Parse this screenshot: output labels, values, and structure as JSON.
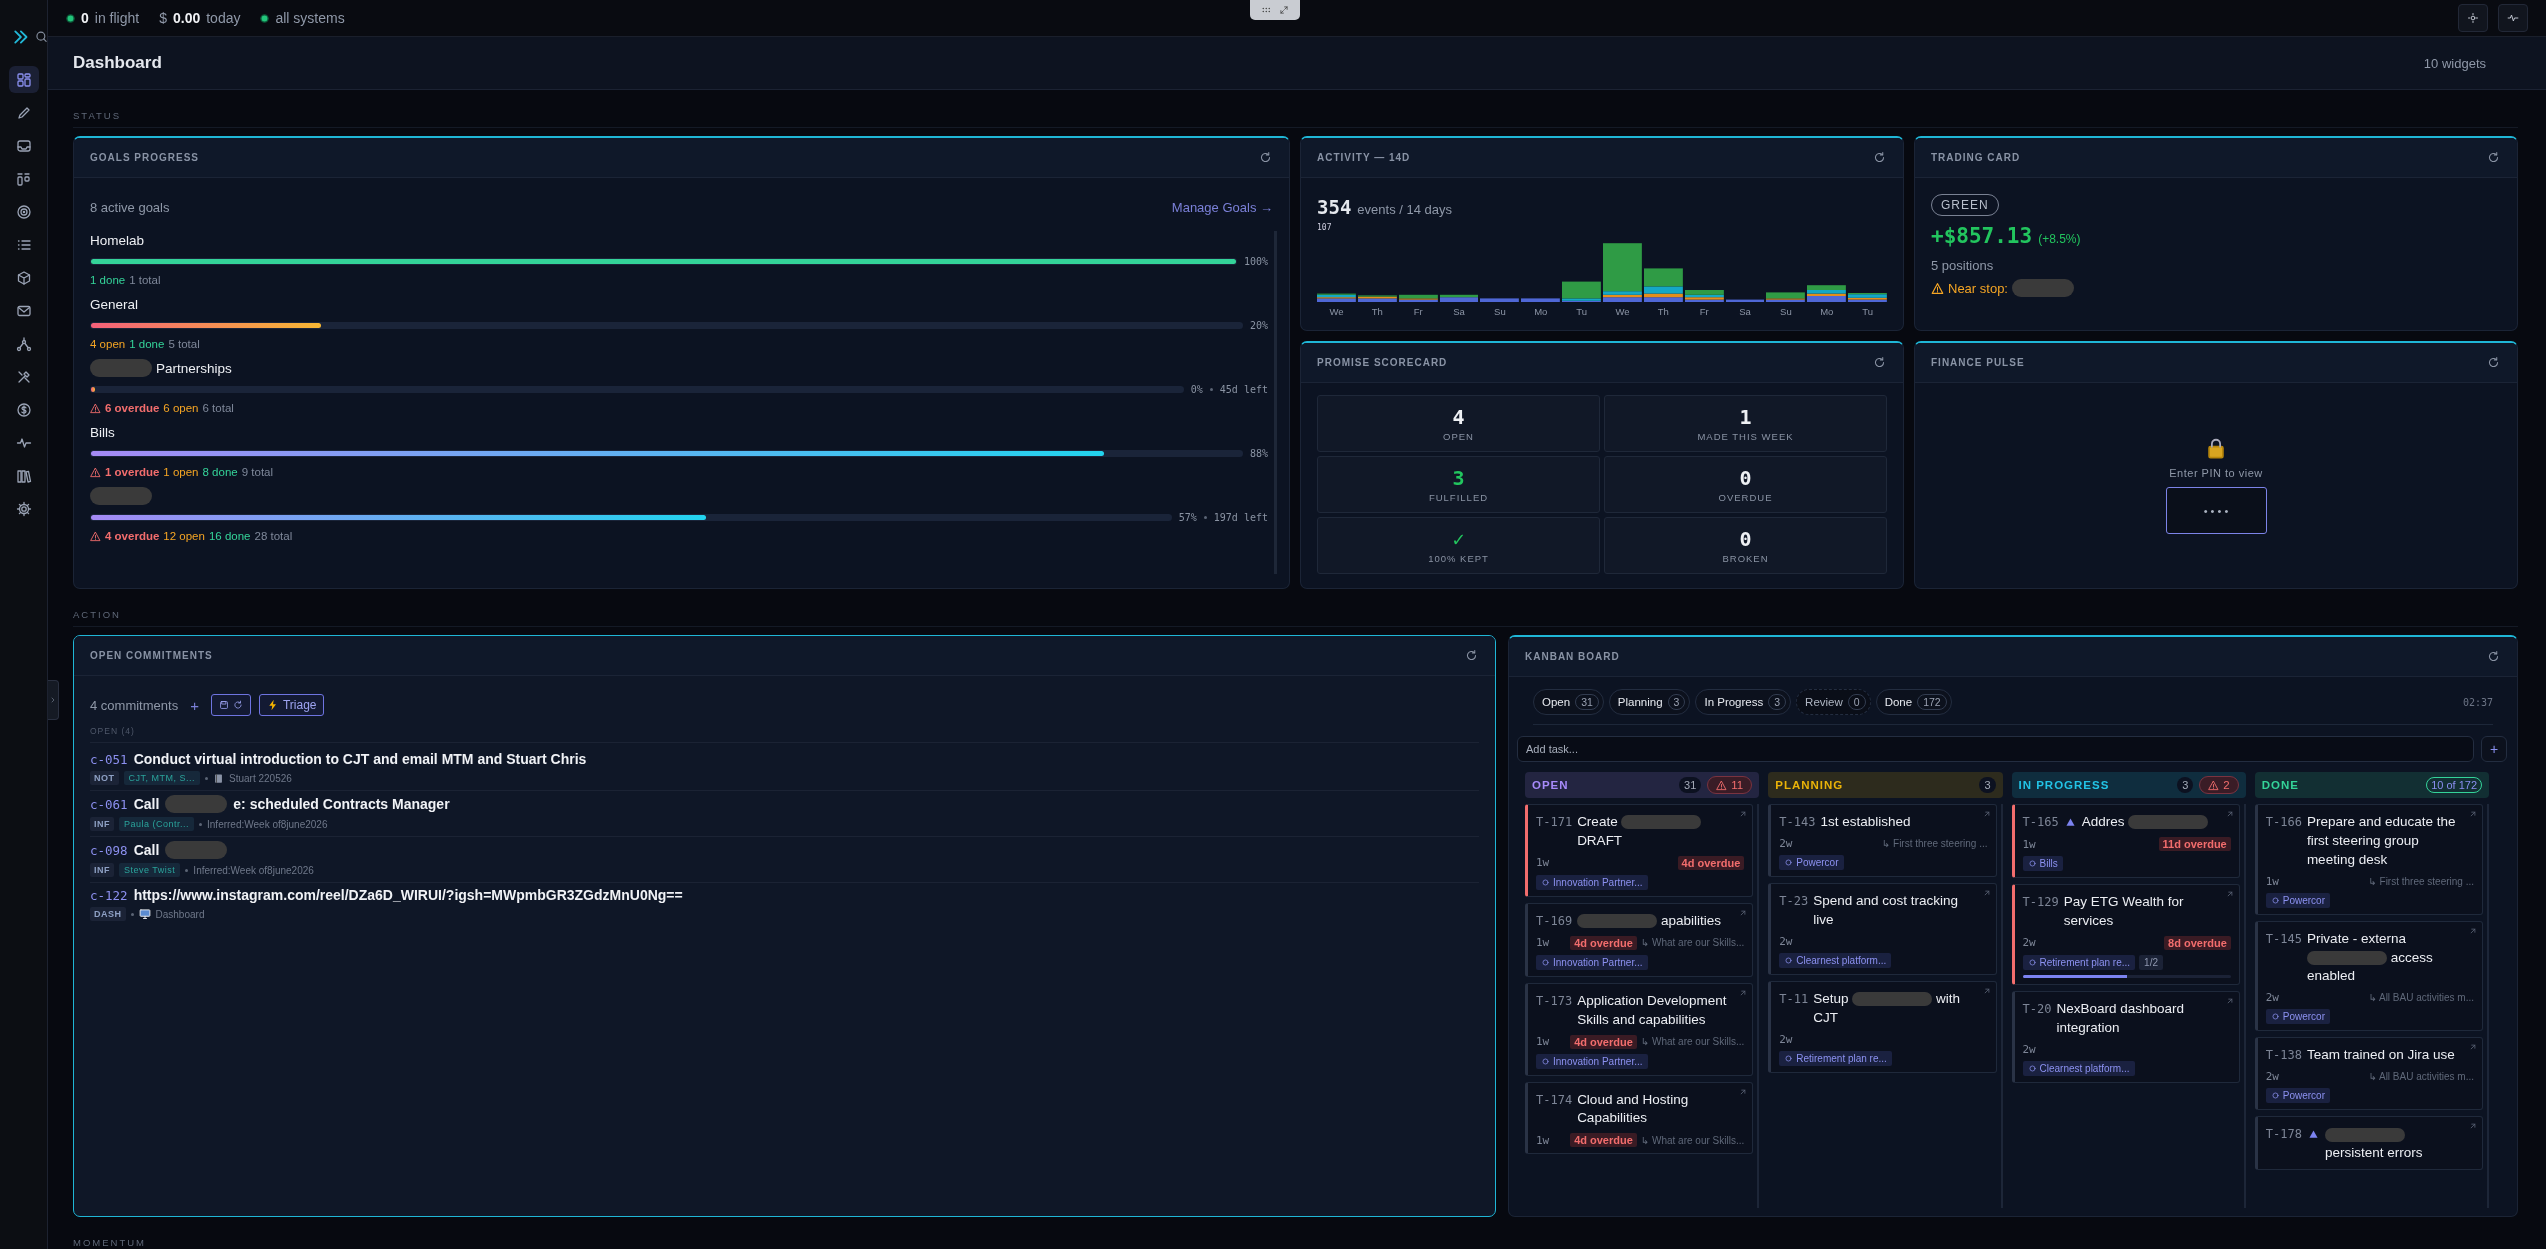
{
  "status_bar": {
    "in_flight": {
      "value": "0",
      "label": "in flight"
    },
    "spend": {
      "currency": "$",
      "value": "0.00",
      "label": "today"
    },
    "systems": {
      "label": "all systems"
    }
  },
  "sidebar": {
    "items": [
      {
        "kind": "grid",
        "selected": true
      },
      {
        "kind": "pencil",
        "selected": false
      },
      {
        "kind": "inbox",
        "selected": false
      },
      {
        "kind": "board",
        "selected": false
      },
      {
        "kind": "target",
        "selected": false
      },
      {
        "kind": "list",
        "selected": false
      },
      {
        "kind": "cube",
        "selected": false
      },
      {
        "kind": "mail",
        "selected": false
      },
      {
        "kind": "nodes",
        "selected": false
      },
      {
        "kind": "tools",
        "selected": false
      },
      {
        "kind": "dollar",
        "selected": false
      },
      {
        "kind": "pulse",
        "selected": false
      },
      {
        "kind": "books",
        "selected": false
      },
      {
        "kind": "gear",
        "selected": false
      }
    ]
  },
  "header": {
    "title": "Dashboard",
    "widget_count": "10 widgets"
  },
  "sections": [
    {
      "label": "STATUS"
    },
    {
      "label": "ACTION"
    },
    {
      "label": "MOMENTUM"
    }
  ],
  "goals_progress": {
    "title": "GOALS PROGRESS",
    "highlighted": false,
    "summary": "8 active goals",
    "link": "Manage Goals →",
    "goals": [
      {
        "name": [
          {
            "kind": "text",
            "text": "Homelab"
          }
        ],
        "kind": "complete",
        "level": 1.0,
        "percent": "100%",
        "stats": [
          {
            "kind": "done",
            "text": "1 done"
          },
          {
            "kind": "total",
            "text": "1 total"
          }
        ]
      },
      {
        "name": [
          {
            "kind": "text",
            "text": "General"
          }
        ],
        "kind": "warm",
        "level": 0.2,
        "percent": "20%",
        "stats": [
          {
            "kind": "open",
            "text": "4 open"
          },
          {
            "kind": "done",
            "text": "1 done"
          },
          {
            "kind": "total",
            "text": "5 total"
          }
        ]
      },
      {
        "name": [
          {
            "kind": "redacted"
          },
          {
            "kind": "text",
            "text": "Partnerships"
          }
        ],
        "kind": "warm",
        "level": 0.0,
        "percent": "0%",
        "time_left": "45d left",
        "stats": [
          {
            "kind": "overdue",
            "text": "6 overdue"
          },
          {
            "kind": "open",
            "text": "6 open"
          },
          {
            "kind": "total",
            "text": "6 total"
          }
        ]
      },
      {
        "name": [
          {
            "kind": "text",
            "text": "Bills"
          }
        ],
        "kind": "cool",
        "level": 0.88,
        "percent": "88%",
        "stats": [
          {
            "kind": "overdue",
            "text": "1 overdue"
          },
          {
            "kind": "open",
            "text": "1 open"
          },
          {
            "kind": "done",
            "text": "8 done"
          },
          {
            "kind": "total",
            "text": "9 total"
          }
        ]
      },
      {
        "name": [
          {
            "kind": "redacted"
          }
        ],
        "kind": "cool",
        "level": 0.57,
        "percent": "57%",
        "time_left": "197d left",
        "stats": [
          {
            "kind": "overdue",
            "text": "4 overdue"
          },
          {
            "kind": "open",
            "text": "12 open"
          },
          {
            "kind": "done",
            "text": "16 done"
          },
          {
            "kind": "total",
            "text": "28 total"
          }
        ]
      }
    ]
  },
  "activity": {
    "title": "ACTIVITY — 14D",
    "highlighted": false,
    "total": "354",
    "total_label": "events / 14 days",
    "peak_label": "107",
    "days": [
      "We",
      "Th",
      "Fr",
      "Sa",
      "Su",
      "Mo",
      "Tu",
      "We",
      "Th",
      "Fr",
      "Sa",
      "Su",
      "Mo",
      "Tu"
    ]
  },
  "trading_card": {
    "title": "TRADING CARD",
    "highlighted": false,
    "badge": "GREEN",
    "pnl": "+$857.13",
    "change": "(+8.5%)",
    "positions": "5 positions",
    "warning": [
      {
        "kind": "text",
        "text": "Near stop:"
      },
      {
        "kind": "redacted"
      }
    ]
  },
  "promise_scorecard": {
    "title": "PROMISE SCORECARD",
    "highlighted": false,
    "tiles": [
      {
        "value": "4",
        "label": "OPEN",
        "kind": "plain"
      },
      {
        "value": "1",
        "label": "MADE THIS WEEK",
        "kind": "plain"
      },
      {
        "value": "3",
        "label": "FULFILLED",
        "kind": "good"
      },
      {
        "value": "0",
        "label": "OVERDUE",
        "kind": "plain"
      },
      {
        "value": "✓",
        "label": "100% KEPT",
        "kind": "good"
      },
      {
        "value": "0",
        "label": "BROKEN",
        "kind": "plain"
      }
    ]
  },
  "finance_pulse": {
    "title": "FINANCE PULSE",
    "highlighted": false,
    "prompt": "Enter PIN to view",
    "pin": "• • • •"
  },
  "open_commitments": {
    "title": "OPEN COMMITMENTS",
    "highlighted": true,
    "count": "4 commitments",
    "add": "+",
    "triage": "Triage",
    "group": "OPEN (4)",
    "items": [
      {
        "id": "c-051",
        "title": [
          {
            "kind": "text",
            "text": "Conduct virtual introduction to CJT and email MTM and Stuart Chris"
          }
        ],
        "type": "NOT",
        "person": "CJT, MTM, S...",
        "source": {
          "kind": "book",
          "text": "Stuart 220526"
        }
      },
      {
        "id": "c-061",
        "title": [
          {
            "kind": "text",
            "text": "Call"
          },
          {
            "kind": "redacted"
          },
          {
            "kind": "text",
            "text": "e: scheduled Contracts Manager"
          }
        ],
        "type": "INF",
        "person": "Paula (Contr...",
        "source": {
          "text": "Inferred:Week of8june2026"
        }
      },
      {
        "id": "c-098",
        "title": [
          {
            "kind": "text",
            "text": "Call"
          },
          {
            "kind": "redacted"
          }
        ],
        "type": "INF",
        "person": "Steve Twist",
        "source": {
          "text": "Inferred:Week of8june2026"
        }
      },
      {
        "id": "c-122",
        "title": [
          {
            "kind": "text",
            "text": "https://www.instagram.com/reel/DZa6D_WIRUI/?igsh=MWpmbGR3ZGdzMnU0Ng=="
          }
        ],
        "type": "DASH",
        "source": {
          "kind": "monitor",
          "text": "Dashboard"
        }
      }
    ]
  },
  "kanban": {
    "title": "KANBAN BOARD",
    "highlighted": false,
    "time": "02:37",
    "add_placeholder": "Add task...",
    "add_button": "+",
    "filters": [
      {
        "label": "Open",
        "count": "31",
        "disabled": false
      },
      {
        "label": "Planning",
        "count": "3",
        "disabled": false
      },
      {
        "label": "In Progress",
        "count": "3",
        "disabled": false
      },
      {
        "label": "Review",
        "count": "0",
        "disabled": true
      },
      {
        "label": "Done",
        "count": "172",
        "disabled": false
      }
    ],
    "columns": [
      {
        "title": "OPEN",
        "color": "#a78bfa",
        "count": "31",
        "alerts": "11",
        "cards": [
          {
            "id": "T-171",
            "title": [
              {
                "kind": "text",
                "text": "Create"
              },
              {
                "kind": "redacted"
              },
              {
                "kind": "text",
                "text": "DRAFT"
              }
            ],
            "age": "1w",
            "overdue": true,
            "overdue_label": "4d overdue",
            "tag": "Innovation Partner..."
          },
          {
            "id": "T-169",
            "title": [
              {
                "kind": "redacted"
              },
              {
                "kind": "text",
                "text": "apabilities"
              }
            ],
            "age": "1w",
            "overdue": false,
            "overdue_label": "4d overdue",
            "parent": "↳ What are our Skills...",
            "tag": "Innovation Partner..."
          },
          {
            "id": "T-173",
            "title": [
              {
                "kind": "text",
                "text": "Application Development Skills and capabilities"
              }
            ],
            "age": "1w",
            "overdue": false,
            "overdue_label": "4d overdue",
            "parent": "↳ What are our Skills...",
            "tag": "Innovation Partner..."
          },
          {
            "id": "T-174",
            "title": [
              {
                "kind": "text",
                "text": "Cloud and Hosting Capabilities"
              }
            ],
            "age": "1w",
            "overdue": false,
            "overdue_label": "4d overdue",
            "parent": "↳ What are our Skills..."
          }
        ]
      },
      {
        "title": "PLANNING",
        "color": "#eab308",
        "count": "3",
        "cards": [
          {
            "id": "T-143",
            "title": [
              {
                "kind": "text",
                "text": "1st established"
              }
            ],
            "age": "2w",
            "overdue": false,
            "parent": "↳ First three steering ...",
            "tag": "Powercor"
          },
          {
            "id": "T-23",
            "title": [
              {
                "kind": "text",
                "text": "Spend and cost tracking live"
              }
            ],
            "age": "2w",
            "overdue": false,
            "tag": "Clearnest platform..."
          },
          {
            "id": "T-11",
            "title": [
              {
                "kind": "text",
                "text": "Setup"
              },
              {
                "kind": "redacted"
              },
              {
                "kind": "text",
                "text": "with CJT"
              }
            ],
            "age": "2w",
            "overdue": false,
            "tag": "Retirement plan re..."
          }
        ]
      },
      {
        "title": "IN PROGRESS",
        "color": "#22c3e6",
        "count": "3",
        "alerts": "2",
        "cards": [
          {
            "id": "T-165",
            "flagged": true,
            "title": [
              {
                "kind": "text",
                "text": "Addres"
              },
              {
                "kind": "redacted"
              }
            ],
            "age": "1w",
            "overdue": true,
            "overdue_label": "11d overdue",
            "tag": "Bills"
          },
          {
            "id": "T-129",
            "title": [
              {
                "kind": "text",
                "text": "Pay ETG Wealth for services"
              }
            ],
            "age": "2w",
            "overdue": true,
            "overdue_label": "8d overdue",
            "tag": "Retirement plan re...",
            "progress": "1/2",
            "level": 0.5
          },
          {
            "id": "T-20",
            "title": [
              {
                "kind": "text",
                "text": "NexBoard dashboard integration"
              }
            ],
            "age": "2w",
            "overdue": false,
            "tag": "Clearnest platform..."
          }
        ]
      },
      {
        "title": "DONE",
        "color": "#34d399",
        "shown": "10 of 172",
        "cards": [
          {
            "id": "T-166",
            "title": [
              {
                "kind": "text",
                "text": "Prepare and educate the first steering group meeting desk"
              }
            ],
            "age": "1w",
            "overdue": false,
            "parent": "↳ First three steering ...",
            "tag": "Powercor"
          },
          {
            "id": "T-145",
            "title": [
              {
                "kind": "text",
                "text": "Private - externa"
              },
              {
                "kind": "redacted"
              },
              {
                "kind": "text",
                "text": "access enabled"
              }
            ],
            "age": "2w",
            "overdue": false,
            "parent": "↳ All BAU activities m...",
            "tag": "Powercor"
          },
          {
            "id": "T-138",
            "title": [
              {
                "kind": "text",
                "text": "Team trained on Jira use"
              }
            ],
            "age": "2w",
            "overdue": false,
            "parent": "↳ All BAU activities m...",
            "tag": "Powercor"
          },
          {
            "id": "T-178",
            "flagged": true,
            "overdue": false,
            "title": [
              {
                "kind": "redacted"
              },
              {
                "kind": "text",
                "text": "persistent errors"
              }
            ]
          }
        ]
      }
    ]
  }
}
